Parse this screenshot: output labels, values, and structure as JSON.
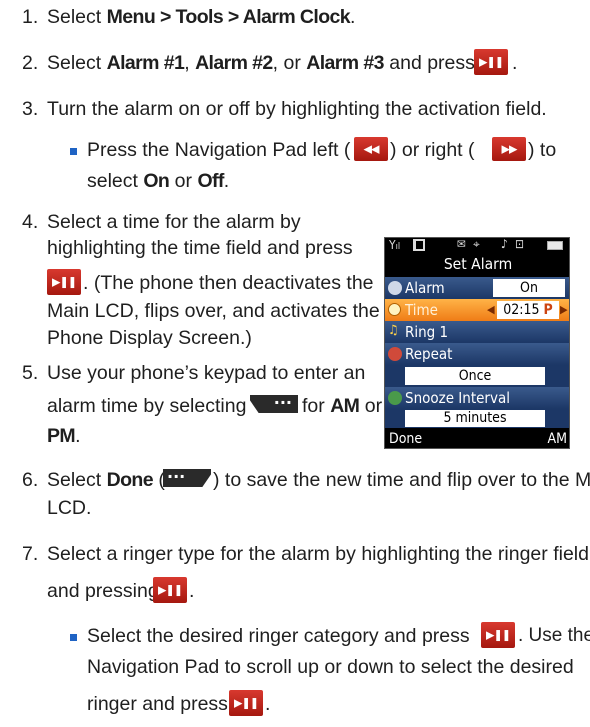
{
  "steps": {
    "s1": {
      "num": "1.",
      "a": "Select ",
      "b1": "Menu > Tools > Alarm Clock",
      "c": "."
    },
    "s2": {
      "num": "2.",
      "a": "Select ",
      "b1": "Alarm #1",
      "c1": ", ",
      "b2": "Alarm #2",
      "c2": ", or ",
      "b3": "Alarm #3",
      "c3": " and press ",
      "d": "."
    },
    "s3": {
      "num": "3.",
      "text": "Turn the alarm on or off by highlighting the activation field.",
      "sub": {
        "a": "Press the Navigation Pad left (",
        "b": ") or right (",
        "c": ") to",
        "d": "select ",
        "on": "On",
        "or": " or ",
        "off": "Off",
        "e": "."
      }
    },
    "s4": {
      "num": "4.",
      "l1": "Select a time for the alarm by",
      "l2": "highlighting the time field and press",
      "l3": ". (The phone then deactivates the",
      "l4": "Main LCD, flips over, and activates the",
      "l5": "Phone Display Screen.)"
    },
    "s5": {
      "num": "5.",
      "l1": "Use your phone’s keypad to enter an",
      "l2a": "alarm time by selecting ",
      "l2b": " for ",
      "am": "AM",
      "l2c": " or",
      "pm": "PM",
      "l3": "."
    },
    "s6": {
      "num": "6.",
      "a": "Select ",
      "done": "Done",
      "b": " (",
      "c": ") to save the new time and flip over to the Main",
      "l2": "LCD."
    },
    "s7": {
      "num": "7.",
      "l1": "Select a ringer type for the alarm by highlighting the ringer field",
      "l2a": "and pressing ",
      "l2b": ".",
      "sub": {
        "l1a": "Select the desired ringer category and press ",
        "l1b": ". Use the",
        "l2": "Navigation Pad to scroll up or down to select the desired",
        "l3a": "ringer and press ",
        "l3b": "."
      }
    }
  },
  "keys": {
    "play": "play-pause-icon",
    "prev": "rewind-icon",
    "next": "fast-forward-icon",
    "soft_left": "left-soft-key-icon",
    "soft_right": "right-soft-key-icon",
    "glyph_play": "▶❚❚",
    "glyph_prev": "◀◀",
    "glyph_next": "▶▶",
    "glyph_dots": "···"
  },
  "phone": {
    "status": {
      "signal": "Y",
      "signal_bars": "ıl",
      "e": "✉",
      "gps": "⌖",
      "music": "♪",
      "lock": "⊡"
    },
    "title": "Set Alarm",
    "rows": {
      "alarm_label": "Alarm",
      "alarm_value": "On",
      "time_label": "Time",
      "time_value": "02:15",
      "time_ampm": "P",
      "ring_label": "Ring 1",
      "repeat_label": "Repeat",
      "repeat_value": "Once",
      "snooze_label": "Snooze Interval",
      "snooze_value": "5 minutes"
    },
    "soft_left": "Done",
    "soft_right": "AM"
  },
  "colors": {
    "key_red": "#c4261b",
    "bullet_blue": "#1f63c4",
    "highlight_orange": "#f08a1e",
    "row_blue": "#2a4a7c"
  }
}
